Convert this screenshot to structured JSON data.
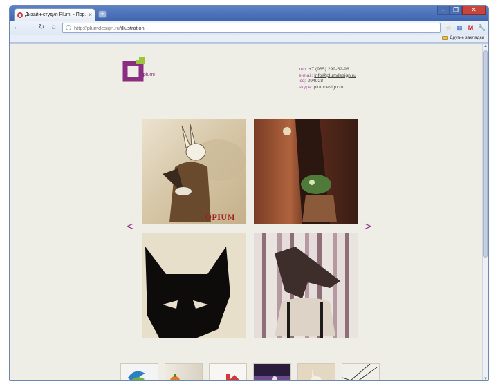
{
  "browser": {
    "tab_title": "Дизайн-студия Plum! - Пор…",
    "tab_close": "×",
    "new_tab": "+",
    "window_buttons": {
      "minimize": "–",
      "maximize": "❐",
      "close": "✕"
    },
    "nav": {
      "back": "←",
      "forward": "→",
      "reload": "↻",
      "home": "⌂"
    },
    "url_host": "http://plumdesign.ru",
    "url_path": "/illustration",
    "toolbar_icons": [
      "star-icon",
      "delicious-icon",
      "gmail-icon",
      "wrench-icon"
    ],
    "toolbar_glyphs": {
      "star": "☆",
      "delicious": "▦",
      "gmail": "M",
      "wrench": "🔧"
    },
    "bookmarks_other": "Другие закладки"
  },
  "site": {
    "logo_text": "plum!",
    "colors": {
      "brand_purple": "#8a2e82",
      "brand_green": "#9bc53d",
      "page_bg": "#efeee6"
    },
    "contacts": [
      {
        "label": "тел:",
        "value": "+7 (985) 299-52-98"
      },
      {
        "label": "e-mail:",
        "value": "info@plumdesign.ru"
      },
      {
        "label": "icq:",
        "value": "294928"
      },
      {
        "label": "skype:",
        "value": "plumdesign.ru"
      }
    ],
    "gallery": {
      "prev": "<",
      "next": ">",
      "tiles": [
        {
          "name": "rabbit-illustration",
          "caption": "OPIUM"
        },
        {
          "name": "curtain-illustration"
        },
        {
          "name": "black-dog-mask-illustration"
        },
        {
          "name": "horse-mask-man-illustration"
        }
      ],
      "thumbnails": [
        "thumb-1",
        "thumb-2",
        "thumb-3",
        "thumb-4",
        "thumb-5",
        "thumb-6"
      ]
    }
  }
}
